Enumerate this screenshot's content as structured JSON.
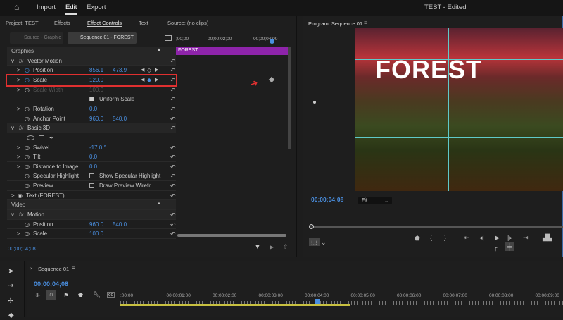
{
  "topbar": {
    "home": "home-icon",
    "import": "Import",
    "edit": "Edit",
    "export": "Export",
    "title": "TEST - Edited"
  },
  "panel_tabs": {
    "project": "Project: TEST",
    "effects": "Effects",
    "effect_controls": "Effect Controls",
    "text": "Text",
    "source": "Source: (no clips)"
  },
  "ec": {
    "source_tab": "Source - Graphic",
    "sequence_tab": "Sequence 01 - FOREST",
    "ruler": [
      ";00;00",
      "00;00;02;00",
      "00;00;04;00"
    ],
    "clip_label": "FOREST",
    "timecode": "00;00;04;08",
    "rows": [
      {
        "type": "section",
        "label": "Graphics"
      },
      {
        "type": "fx",
        "label": "Vector Motion",
        "expand": "v"
      },
      {
        "label": "Position",
        "v1": "856.1",
        "v2": "473.9",
        "expand": ">",
        "kf": true
      },
      {
        "label": "Scale",
        "v1": "120.0",
        "expand": ">",
        "kf": true,
        "active": true
      },
      {
        "label": "Scale Width",
        "v1": "100.0",
        "expand": ">",
        "dim": true
      },
      {
        "label": "",
        "check": "Uniform Scale",
        "checked": true
      },
      {
        "label": "Rotation",
        "v1": "0.0",
        "expand": ">"
      },
      {
        "label": "Anchor Point",
        "v1": "960.0",
        "v2": "540.0"
      },
      {
        "type": "fx",
        "label": "Basic 3D",
        "expand": "v"
      },
      {
        "type": "shapes",
        "label": ""
      },
      {
        "label": "Swivel",
        "v1": "-17.0 °",
        "expand": ">"
      },
      {
        "label": "Tilt",
        "v1": "0.0",
        "expand": ">"
      },
      {
        "label": "Distance to Image",
        "v1": "0.0",
        "expand": ">"
      },
      {
        "label": "Specular Highlight",
        "check": "Show Specular Highlight"
      },
      {
        "label": "Preview",
        "check": "Draw Preview Wirefr..."
      },
      {
        "type": "eye",
        "label": "Text (FOREST)",
        "expand": ">"
      },
      {
        "type": "section",
        "label": "Video"
      },
      {
        "type": "fx",
        "label": "Motion",
        "expand": "v"
      },
      {
        "label": "Position",
        "v1": "960.0",
        "v2": "540.0"
      },
      {
        "label": "Scale",
        "v1": "100.0",
        "expand": ">"
      }
    ]
  },
  "program": {
    "title": "Program: Sequence 01",
    "video_text": "FOREST",
    "timecode": "00;00;04;08",
    "fit": "Fit"
  },
  "timeline": {
    "title": "Sequence 01",
    "timecode": "00;00;04;08",
    "ticks": [
      ";00;00",
      "00;00;01;00",
      "00;00;02;00",
      "00;00;03;00",
      "00;00;04;00",
      "00;00;05;00",
      "00;00;06;00",
      "00;00;07;00",
      "00;00;08;00",
      "00;00;09;00"
    ]
  },
  "colors": {
    "accent": "#4a8fe0",
    "clip": "#8e24aa",
    "highlight": "#e03030"
  }
}
